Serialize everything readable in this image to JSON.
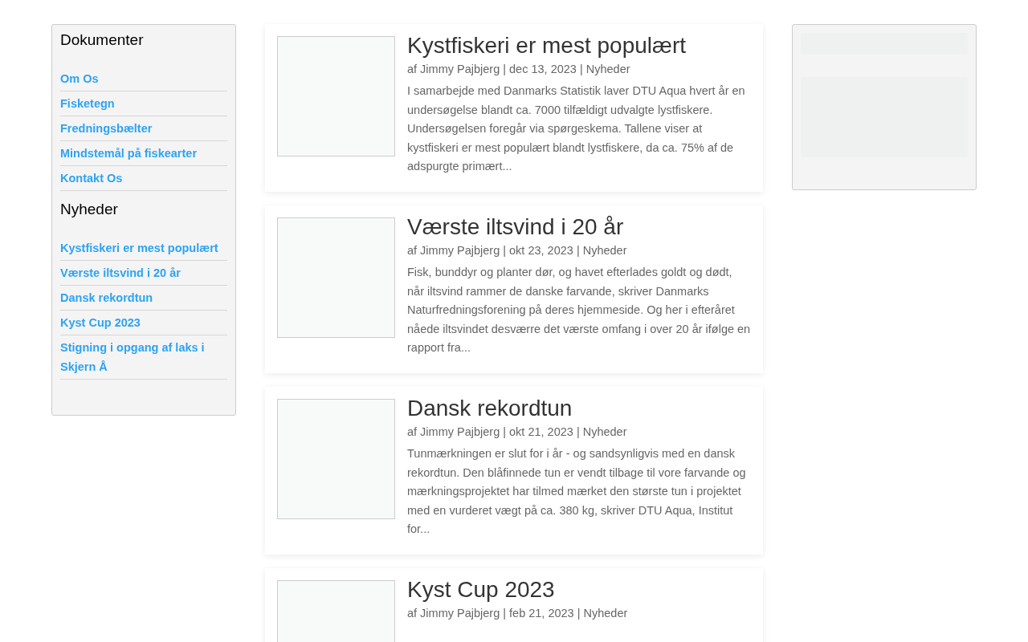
{
  "sidebar": {
    "sections": [
      {
        "heading": "Dokumenter",
        "links": [
          "Om Os",
          "Fisketegn",
          "Fredningsbælter",
          "Mindstemål på fiskearter",
          "Kontakt Os"
        ]
      },
      {
        "heading": "Nyheder",
        "links": [
          "Kystfiskeri er mest populært",
          "Værste iltsvind i 20 år",
          "Dansk rekordtun",
          "Kyst Cup 2023",
          "Stigning i opgang af laks i Skjern Å"
        ]
      }
    ]
  },
  "posts": [
    {
      "title": "Kystfiskeri er mest populært",
      "meta": "af Jimmy Pajbjerg | dec 13, 2023 | Nyheder",
      "excerpt": "I samarbejde med Danmarks Statistik laver DTU Aqua hvert år en undersøgelse blandt ca. 7000 tilfældigt udvalgte lystfiskere. Undersøgelsen foregår via spørgeskema. Tallene viser at kystfiskeri er mest populært blandt lystfiskere, da ca. 75% af de adspurgte primært..."
    },
    {
      "title": "Værste iltsvind i 20 år",
      "meta": "af Jimmy Pajbjerg | okt 23, 2023 | Nyheder",
      "excerpt": "Fisk, bunddyr og planter dør, og havet efterlades goldt og dødt, når iltsvind rammer de danske farvande, skriver Danmarks Naturfredningsforening på deres hjemmeside. Og her i efteråret nåede iltsvindet desværre det værste omfang i over 20 år ifølge en rapport fra..."
    },
    {
      "title": "Dansk rekordtun",
      "meta": "af Jimmy Pajbjerg | okt 21, 2023 | Nyheder",
      "excerpt": "Tunmærkningen er slut for i år - og sandsynligvis med en dansk rekordtun. Den blåfinnede tun er vendt tilbage til vore farvande og mærkningsprojektet har tilmed mærket den største tun i projektet med en vurderet vægt på ca. 380 kg, skriver DTU Aqua, Institut for..."
    },
    {
      "title": "Kyst Cup 2023",
      "meta": "af Jimmy Pajbjerg | feb 21, 2023 | Nyheder"
    }
  ]
}
